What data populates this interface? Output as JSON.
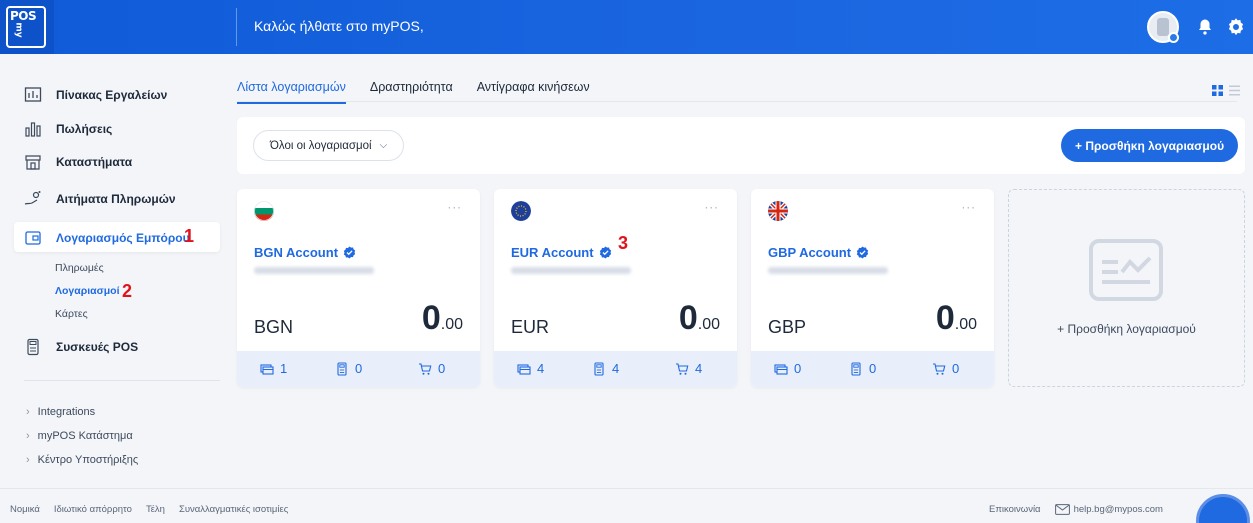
{
  "header": {
    "logo_top": "POS",
    "logo_side": "my",
    "welcome": "Καλώς ήλθατε στο myPOS,"
  },
  "sidebar": {
    "items": [
      {
        "label": "Πίνακας Εργαλείων",
        "icon": "dashboard-icon"
      },
      {
        "label": "Πωλήσεις",
        "icon": "chart-bars-icon"
      },
      {
        "label": "Καταστήματα",
        "icon": "store-icon"
      },
      {
        "label": "Αιτήματα Πληρωμών",
        "icon": "payment-request-icon"
      },
      {
        "label": "Λογαριασμός Εμπόρου",
        "icon": "merchant-account-icon"
      },
      {
        "label": "Συσκευές POS",
        "icon": "pos-device-icon"
      }
    ],
    "sub_items": [
      "Πληρωμές",
      "Λογαριασμοί",
      "Κάρτες"
    ],
    "links": [
      "Integrations",
      "myPOS Κατάστημα",
      "Κέντρο Υποστήριξης"
    ],
    "annotations": [
      "1",
      "2",
      "3"
    ]
  },
  "tabs": [
    "Λίστα λογαριασμών",
    "Δραστηριότητα",
    "Αντίγραφα κινήσεων"
  ],
  "toolbar": {
    "filter_label": "Όλοι οι λογαριασμοί",
    "add_label": "+ Προσθήκη λογαριασμού"
  },
  "accounts": [
    {
      "name": "BGN Account",
      "currency": "BGN",
      "balance_int": "0",
      "balance_dec": ".00",
      "stats": [
        "1",
        "0",
        "0"
      ],
      "flag": "bg-flag-icon"
    },
    {
      "name": "EUR Account",
      "currency": "EUR",
      "balance_int": "0",
      "balance_dec": ".00",
      "stats": [
        "4",
        "4",
        "4"
      ],
      "flag": "eu-flag-icon"
    },
    {
      "name": "GBP Account",
      "currency": "GBP",
      "balance_int": "0",
      "balance_dec": ".00",
      "stats": [
        "0",
        "0",
        "0"
      ],
      "flag": "uk-flag-icon"
    }
  ],
  "add_card_label": "+ Προσθήκη λογαριασμού",
  "footer": {
    "left": [
      "Νομικά",
      "Ιδιωτικό απόρρητο",
      "Τέλη",
      "Συναλλαγματικές ισοτιμίες"
    ],
    "contact": "Επικοινωνία",
    "email": "help.bg@mypos.com"
  },
  "colors": {
    "primary": "#1f6ae0",
    "header": "#1b66e0",
    "annotation": "#e0121c"
  }
}
